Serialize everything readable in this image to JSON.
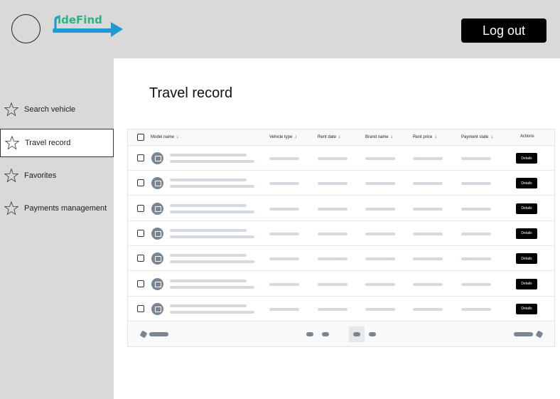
{
  "header": {
    "logo_text": "ideFind",
    "logout_label": "Log out"
  },
  "sidebar": {
    "items": [
      {
        "label": "Search vehicle",
        "icon": "star-icon"
      },
      {
        "label": "Travel record",
        "icon": "star-icon",
        "active": true
      },
      {
        "label": "Favorites",
        "icon": "star-icon"
      },
      {
        "label": "Payments management",
        "icon": "star-icon"
      }
    ]
  },
  "main": {
    "title": "Travel record",
    "table": {
      "columns": [
        "Model name",
        "Vehicle type",
        "Rent date",
        "Brand name",
        "Rent price",
        "Payment state",
        "Actions"
      ],
      "rows": [
        {
          "action_label": "Details"
        },
        {
          "action_label": "Details"
        },
        {
          "action_label": "Details"
        },
        {
          "action_label": "Details"
        },
        {
          "action_label": "Details"
        },
        {
          "action_label": "Details"
        },
        {
          "action_label": "Details"
        }
      ]
    }
  },
  "colors": {
    "header_bg": "#d9d9d9",
    "sidebar_bg": "#d9d9d9",
    "logo_green": "#2ab57d",
    "logo_blue": "#1e9bd0",
    "button_bg": "#000000",
    "skeleton": "#d5d9e0"
  }
}
